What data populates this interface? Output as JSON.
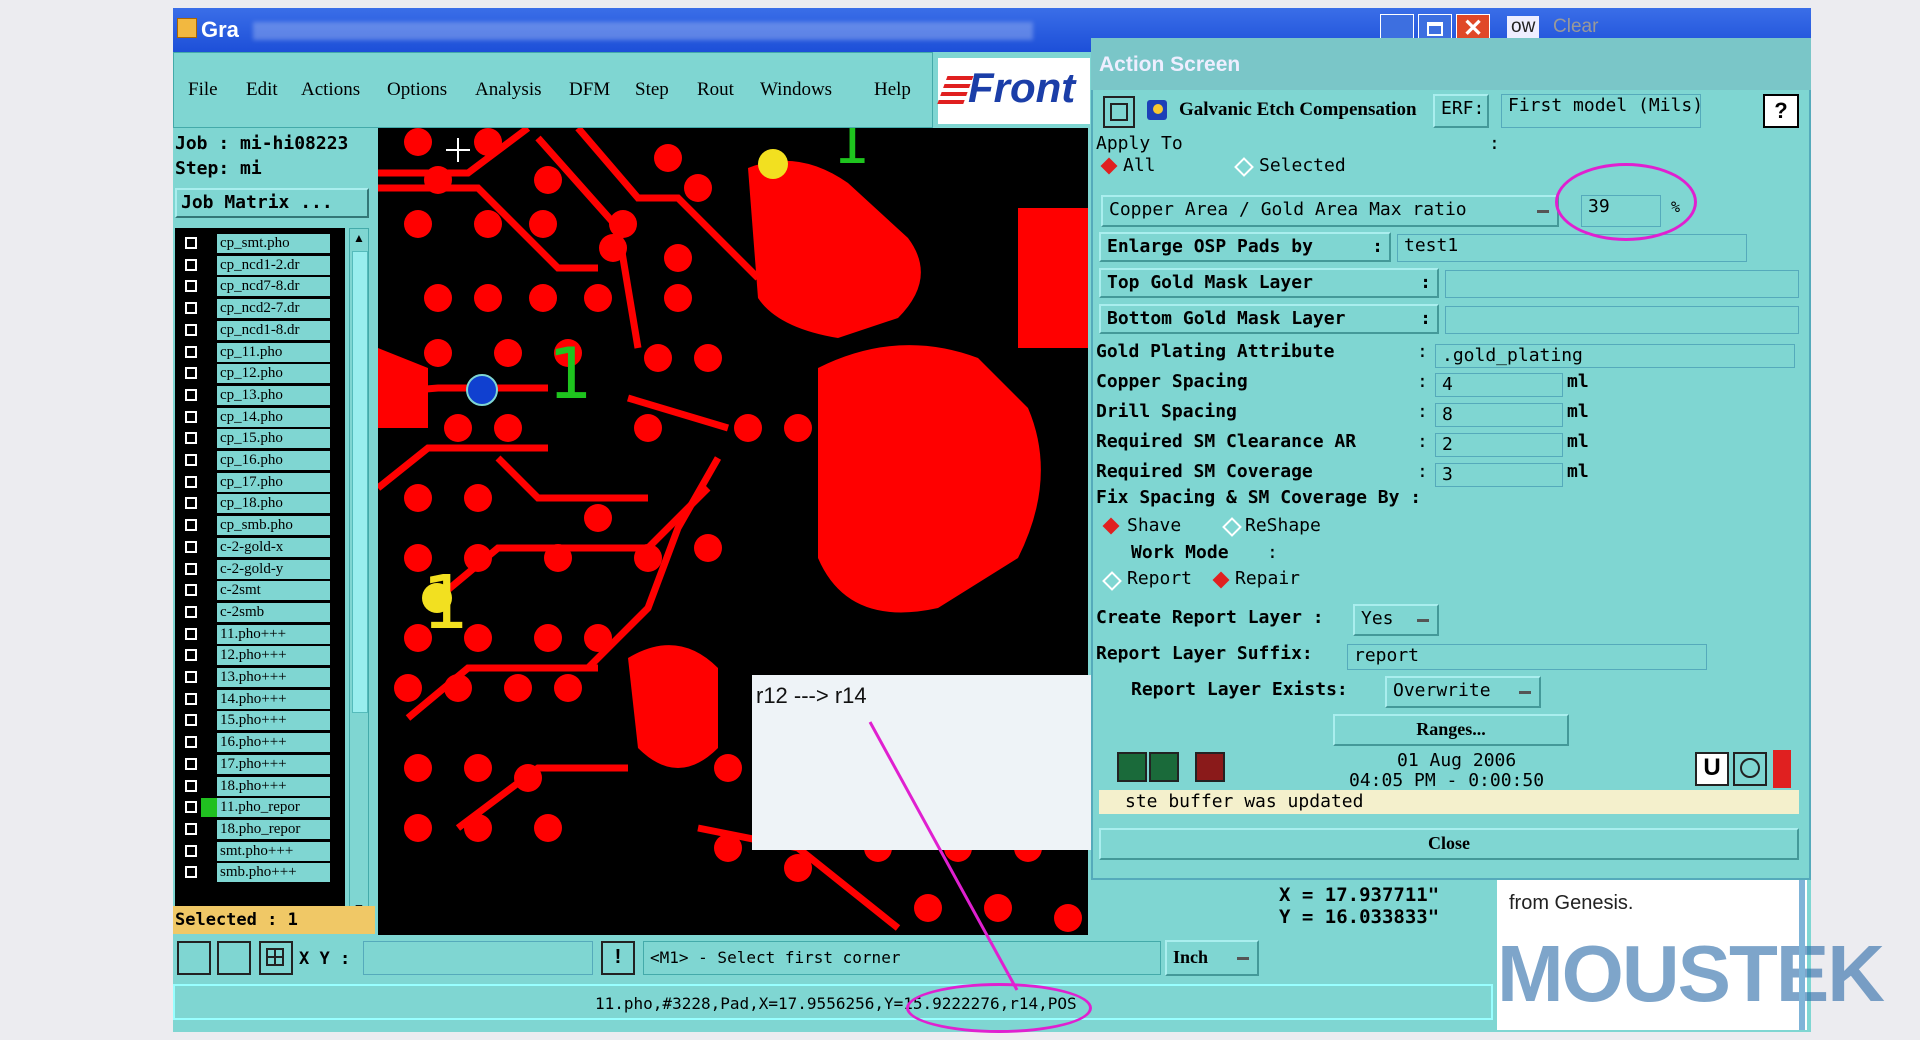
{
  "window": {
    "title": "Gra",
    "title_right_fragment_1": "ow",
    "title_right_fragment_2": "Clear"
  },
  "menu": [
    "File",
    "Edit",
    "Actions",
    "Options",
    "Analysis",
    "DFM",
    "Step",
    "Rout",
    "Windows",
    "Help"
  ],
  "logo_text": "Front",
  "job": {
    "job_label": "Job : mi-hi08223",
    "step_label": "Step: mi",
    "matrix_button": "Job Matrix ...",
    "selected_label": "Selected : 1"
  },
  "layers": [
    "cp_smt.pho",
    "cp_ncd1-2.dr",
    "cp_ncd7-8.dr",
    "cp_ncd2-7.dr",
    "cp_ncd1-8.dr",
    "cp_11.pho",
    "cp_12.pho",
    "cp_13.pho",
    "cp_14.pho",
    "cp_15.pho",
    "cp_16.pho",
    "cp_17.pho",
    "cp_18.pho",
    "cp_smb.pho",
    "c-2-gold-x",
    "c-2-gold-y",
    "c-2smt",
    "c-2smb",
    "11.pho+++",
    "12.pho+++",
    "13.pho+++",
    "14.pho+++",
    "15.pho+++",
    "16.pho+++",
    "17.pho+++",
    "18.pho+++",
    "11.pho_repor",
    "18.pho_repor",
    "smt.pho+++",
    "smb.pho+++"
  ],
  "action_screen": {
    "title": "Action Screen",
    "function_name": "Galvanic Etch Compensation",
    "erf_label": "ERF:",
    "erf_value": "First model (Mils)",
    "help_button": "?",
    "apply_to_label": "Apply To",
    "apply_to_colon": ":",
    "apply_all": "All",
    "apply_selected": "Selected",
    "ratio_option": "Copper Area / Gold Area Max ratio",
    "ratio_value": "39",
    "ratio_unit": "%",
    "enlarge_label": "Enlarge OSP Pads by",
    "enlarge_value": "test1",
    "top_gold_label": "Top Gold Mask Layer",
    "bottom_gold_label": "Bottom Gold Mask Layer",
    "gold_attr_label": "Gold Plating Attribute",
    "gold_attr_value": ".gold_plating",
    "copper_spacing_label": "Copper Spacing",
    "copper_spacing_value": "4",
    "drill_spacing_label": "Drill Spacing",
    "drill_spacing_value": "8",
    "sm_clearance_label": "Required SM Clearance AR",
    "sm_clearance_value": "2",
    "sm_coverage_label": "Required SM Coverage",
    "sm_coverage_value": "3",
    "unit_ml": "ml",
    "fix_label": "Fix Spacing & SM Coverage By :",
    "shave": "Shave",
    "reshape": "ReShape",
    "work_mode_label": "Work Mode",
    "report_option": "Report",
    "repair_option": "Repair",
    "create_report_label": "Create Report Layer :",
    "create_report_value": "Yes",
    "report_suffix_label": "Report Layer Suffix:",
    "report_suffix_value": "report",
    "report_exists_label": "Report Layer Exists:",
    "report_exists_value": "Overwrite",
    "ranges_button": "Ranges...",
    "date": "01 Aug 2006",
    "time": "04:05 PM - 0:00:50",
    "message": "ste buffer was updated",
    "close_button": "Close"
  },
  "coords": {
    "x": "X = 17.937711\"",
    "y": "Y = 16.033833\""
  },
  "bottom": {
    "xy_label": "X Y :",
    "prompt": "<M1> - Select first corner",
    "unit": "Inch",
    "status": "11.pho,#3228,Pad,X=17.9556256,Y=15.9222276,r14,POS"
  },
  "popup_text": "r12 ---> r14",
  "from_genesis": "from Genesis.",
  "watermark": "MOUSTEK",
  "canvas_labels": [
    "1",
    "1",
    "1"
  ],
  "colors": {
    "copper": "#ff0000",
    "panel": "#7fd6d2",
    "annotation": "#e020d0"
  }
}
